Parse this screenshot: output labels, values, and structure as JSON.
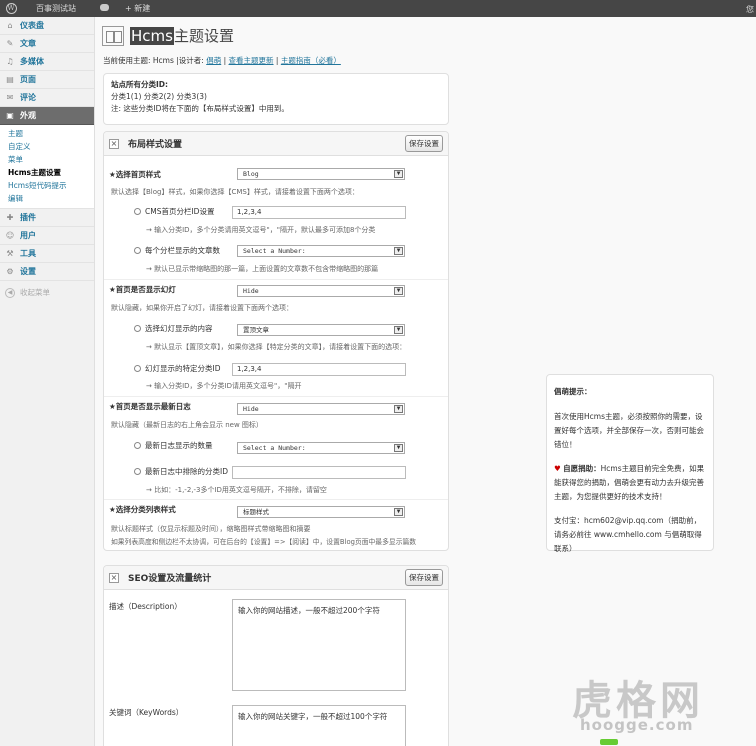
{
  "adminbar": {
    "wp_logo": "W",
    "site_name": "百事测试站",
    "comments_icon": "comment-bubble-icon",
    "new_label": "新建",
    "right_text": "您"
  },
  "sidebar": {
    "items": [
      {
        "icon": "⌂",
        "label": "仪表盘"
      },
      {
        "icon": "✎",
        "label": "文章"
      },
      {
        "icon": "♫",
        "label": "多媒体"
      },
      {
        "icon": "▤",
        "label": "页面"
      },
      {
        "icon": "✉",
        "label": "评论"
      },
      {
        "icon": "▣",
        "label": "外观"
      },
      {
        "icon": "✚",
        "label": "插件"
      },
      {
        "icon": "☺",
        "label": "用户"
      },
      {
        "icon": "⚒",
        "label": "工具"
      },
      {
        "icon": "⚙",
        "label": "设置"
      }
    ],
    "appearance_sub": [
      "主题",
      "自定义",
      "菜单",
      "Hcms主题设置",
      "Hcms短代码提示",
      "编辑"
    ],
    "collapse_label": "收起菜单"
  },
  "header": {
    "title_hl": "Hcms",
    "title_rest": "主题设置"
  },
  "theme_line": {
    "prefix": "当前使用主题: Hcms |设计者:",
    "designer": "倡萌",
    "sep1": "|",
    "link1": "查看主题更新",
    "sep2": "|",
    "link2": "主题指南（必看）"
  },
  "categories": {
    "title": "站点所有分类ID:",
    "list": "分类1(1)  分类2(2)  分类3(3)",
    "note": "注: 这些分类ID将在下面的【布局样式设置】中用到。"
  },
  "layout": {
    "title": "布局样式设置",
    "save": "保存设置",
    "home_style_label": "★选择首页样式",
    "home_style_value": "Blog",
    "home_style_help": "默认选择【Blog】样式，如果你选择【CMS】样式，请接着设置下面两个选项：",
    "cms_cat_label": "CMS首页分栏ID设置",
    "cms_cat_value": "1,2,3,4",
    "cms_cat_help": "→ 输入分类ID，多个分类请用英文逗号\"，\"隔开，默认最多可添加8个分类",
    "posts_per_label": "每个分栏显示的文章数",
    "posts_per_value": "Select a Number:",
    "posts_per_help": "→ 默认已显示带缩略图的那一篇，上面设置的文章数不包含带缩略图的那篇",
    "slider_label": "★首页是否显示幻灯",
    "slider_value": "Hide",
    "slider_help": "默认隐藏，如果你开启了幻灯，请接着设置下面两个选项：",
    "slider_content_label": "选择幻灯显示的内容",
    "slider_content_value": "置顶文章",
    "slider_content_help": "→ 默认显示【置顶文章】，如果你选择【特定分类的文章】，请接着设置下面的选项：",
    "slider_cat_label": "幻灯显示的特定分类ID",
    "slider_cat_value": "1,2,3,4",
    "slider_cat_help": "→ 输入分类ID，多个分类ID请用英文逗号\"，\"隔开",
    "latest_label": "★首页是否显示最新日志",
    "latest_value": "Hide",
    "latest_help": "默认隐藏（最新日志的右上角会显示 new 图标）",
    "latest_num_label": "最新日志显示的数量",
    "latest_num_value": "Select a Number:",
    "latest_excl_label": "最新日志中排除的分类ID",
    "latest_excl_value": "",
    "latest_excl_help": "→ 比如：-1,-2,-3多个ID用英文逗号隔开，不排除，请留空",
    "list_style_label": "★选择分类列表样式",
    "list_style_value": "标题样式",
    "list_style_help1": "默认标题样式（仅显示标题及时间），缩略图样式带缩略图和摘要",
    "list_style_help2": "如果列表高度和侧边栏不太协调，可在后台的【设置】=>【阅读】中，设置Blog页面中最多显示篇数"
  },
  "seo": {
    "title": "SEO设置及流量统计",
    "save": "保存设置",
    "desc_label": "描述（Description）",
    "desc_value": "输入你的网站描述，一般不超过200个字符",
    "kw_label": "关键词（KeyWords）",
    "kw_value": "输入你的网站关键字，一般不超过100个字符"
  },
  "donate": {
    "title": "倡萌提示：",
    "p1": "首次使用Hcms主题，必须按照你的需要，设置好每个选项，并全部保存一次，否则可能会错位！",
    "p2_bold": "自愿捐助：",
    "p2": "Hcms主题目前完全免费，如果能获得您的捐助，倡萌会更有动力去升级完善主题，为您提供更好的技术支持！",
    "p3": "支付宝：hcm602@vip.qq.com（捐助前，请务必前往 www.cmhello.com 与倡萌取得联系）"
  },
  "watermark": {
    "big": "虎格网",
    "small": "hoogge.com"
  }
}
